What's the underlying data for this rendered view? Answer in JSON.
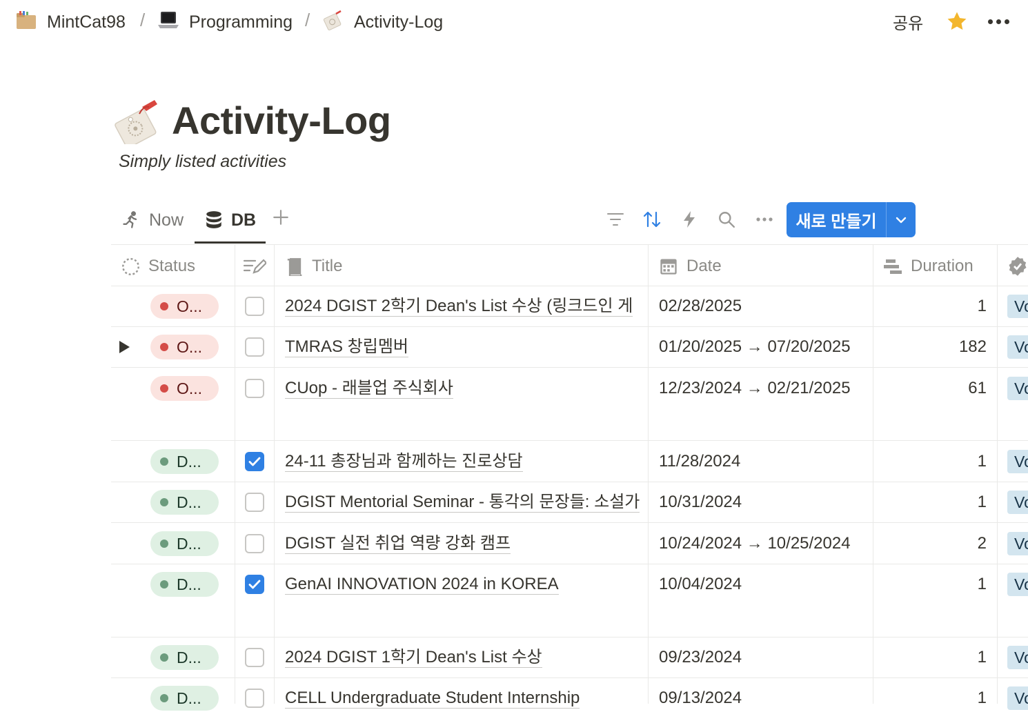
{
  "breadcrumb": {
    "items": [
      "MintCat98",
      "Programming",
      "Activity-Log"
    ],
    "separator": "/"
  },
  "topbar": {
    "share_label": "공유"
  },
  "page": {
    "title": "Activity-Log",
    "description": "Simply listed activities"
  },
  "views": {
    "tabs": [
      "Now",
      "DB"
    ],
    "active": "DB"
  },
  "toolbar": {
    "icons": [
      "filter-icon",
      "sort-icon",
      "automation-icon",
      "search-icon",
      "more-icon"
    ],
    "new_button_label": "새로 만들기"
  },
  "table": {
    "columns": [
      "Status",
      "",
      "Title",
      "Date",
      "Duration"
    ],
    "rows": [
      {
        "status": "O...",
        "status_color": "red",
        "checked": false,
        "has_toggle": false,
        "title": "2024 DGIST 2학기 Dean's List 수상 (링크드인 게",
        "date": "02/28/2025",
        "duration": "1",
        "tag": "Vo"
      },
      {
        "status": "O...",
        "status_color": "red",
        "checked": false,
        "has_toggle": true,
        "title": "TMRAS 창립멤버",
        "date": "01/20/2025 → 07/20/2025",
        "duration": "182",
        "tag": "Vo"
      },
      {
        "status": "O...",
        "status_color": "red",
        "checked": false,
        "has_toggle": false,
        "title": "CUop - 래블업 주식회사",
        "date": "12/23/2024 → 02/21/2025",
        "duration": "61",
        "tag": "Vo"
      },
      {
        "status": "D...",
        "status_color": "green",
        "checked": true,
        "has_toggle": false,
        "title": "24-11 총장님과 함께하는 진로상담",
        "date": "11/28/2024",
        "duration": "1",
        "tag": "Vo"
      },
      {
        "status": "D...",
        "status_color": "green",
        "checked": false,
        "has_toggle": false,
        "title": "DGIST Mentorial Seminar - 통각의 문장들: 소설가",
        "date": "10/31/2024",
        "duration": "1",
        "tag": "Vo"
      },
      {
        "status": "D...",
        "status_color": "green",
        "checked": false,
        "has_toggle": false,
        "title": "DGIST 실전 취업 역량 강화 캠프",
        "date": "10/24/2024 → 10/25/2024",
        "duration": "2",
        "tag": "Vo"
      },
      {
        "status": "D...",
        "status_color": "green",
        "checked": true,
        "has_toggle": false,
        "title": "GenAI INNOVATION 2024 in KOREA",
        "date": "10/04/2024",
        "duration": "1",
        "tag": "Vo"
      },
      {
        "status": "D...",
        "status_color": "green",
        "checked": false,
        "has_toggle": false,
        "title": "2024 DGIST 1학기 Dean's List 수상",
        "date": "09/23/2024",
        "duration": "1",
        "tag": "Vo"
      },
      {
        "status": "D...",
        "status_color": "green",
        "checked": false,
        "has_toggle": false,
        "title": "CELL Undergraduate Student Internship",
        "date": "09/13/2024",
        "duration": "1",
        "tag": "Vo"
      }
    ]
  },
  "colors": {
    "accent": "#2f80e3",
    "star": "#f3b62d",
    "status_red": "#d44c47",
    "status_green": "#6c9b7d"
  }
}
